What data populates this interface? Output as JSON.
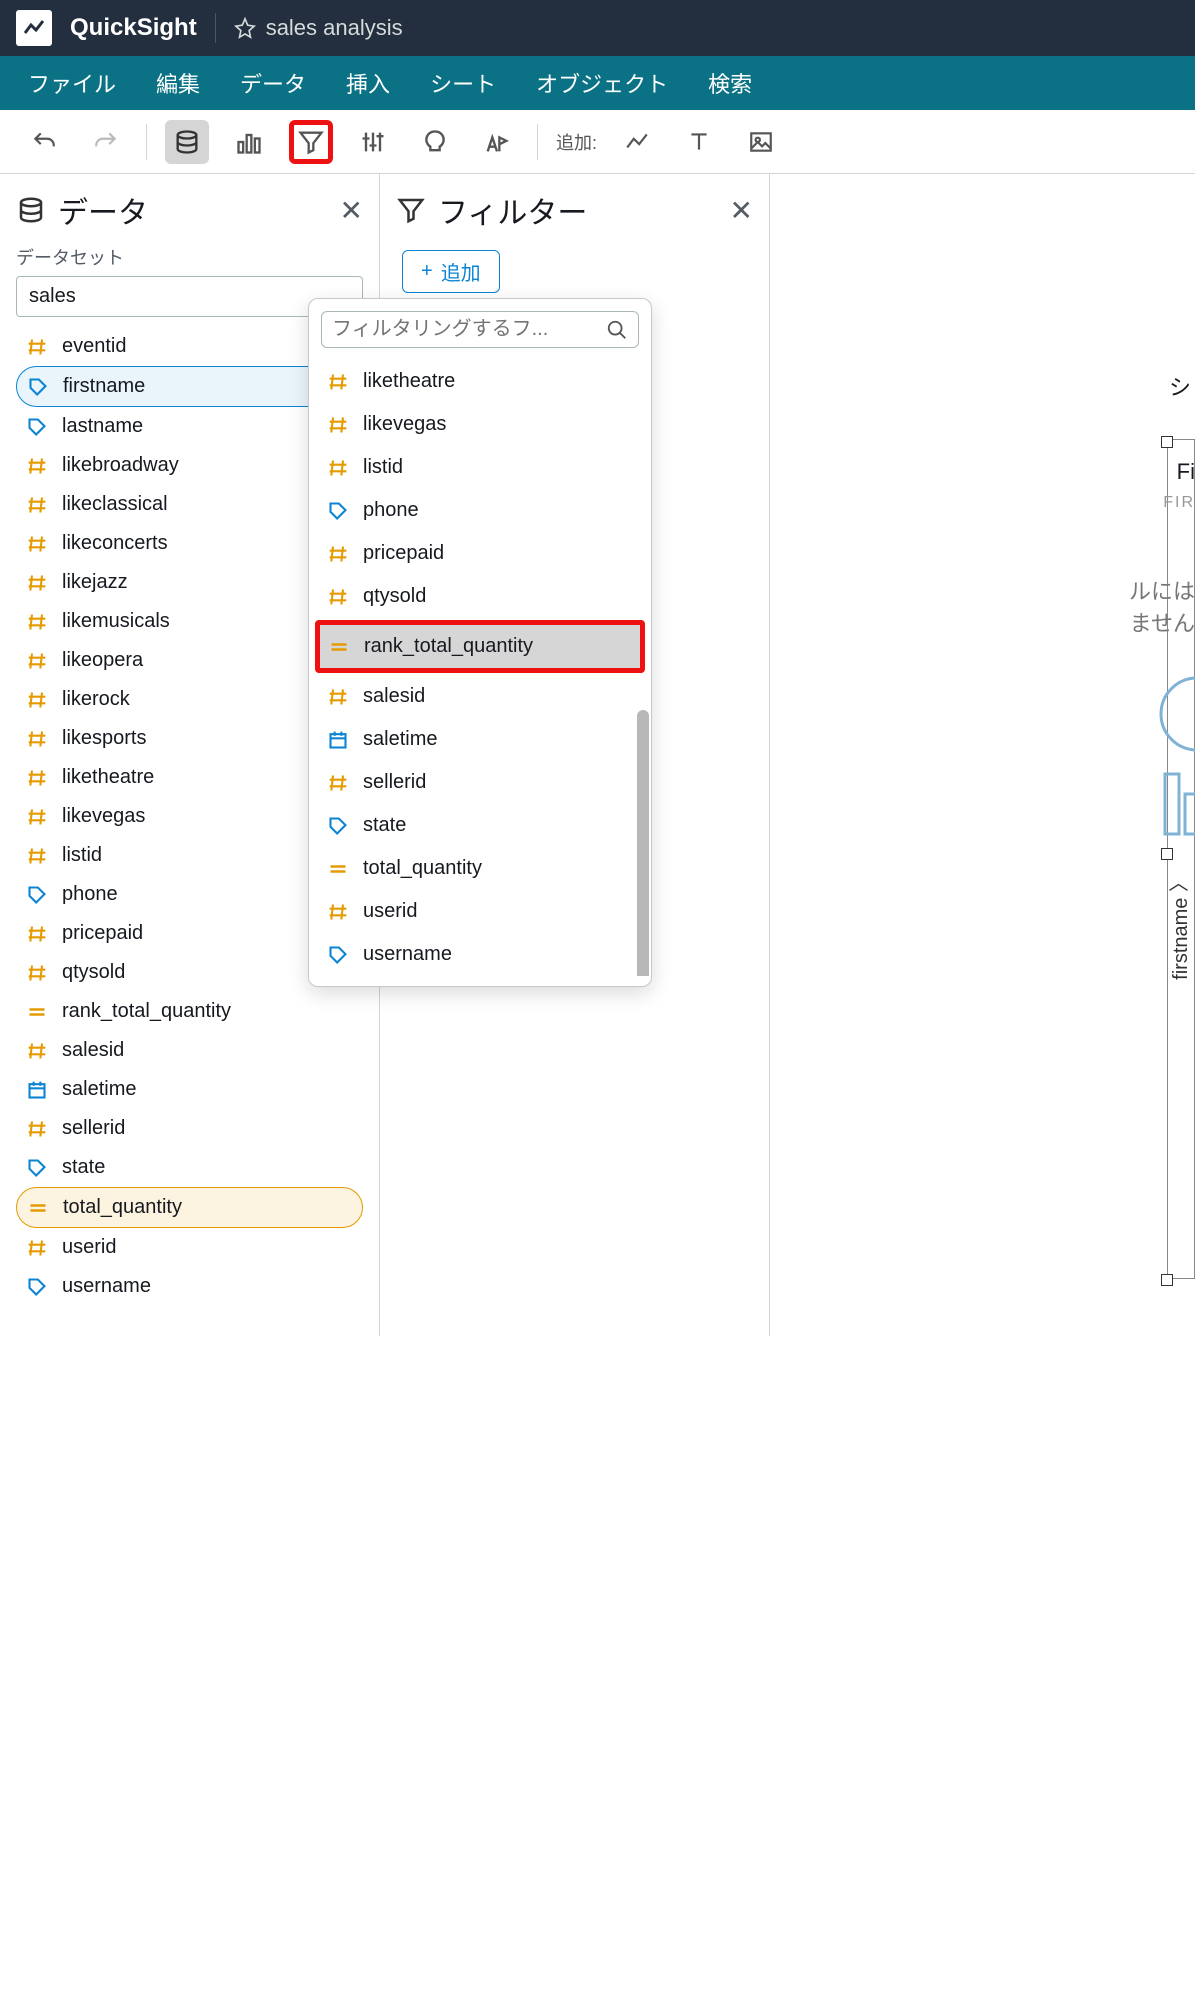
{
  "app": {
    "product": "QuickSight",
    "analysis": "sales analysis"
  },
  "menu": {
    "file": "ファイル",
    "edit": "編集",
    "data": "データ",
    "insert": "挿入",
    "sheet": "シート",
    "object": "オブジェクト",
    "search": "検索"
  },
  "toolbar": {
    "add_label": "追加:"
  },
  "data_panel": {
    "title": "データ",
    "dataset_label": "データセット",
    "dataset_value": "sales",
    "fields": [
      {
        "type": "hash",
        "name": "eventid"
      },
      {
        "type": "tag",
        "name": "firstname",
        "sel": "blue"
      },
      {
        "type": "tag",
        "name": "lastname"
      },
      {
        "type": "hash",
        "name": "likebroadway"
      },
      {
        "type": "hash",
        "name": "likeclassical"
      },
      {
        "type": "hash",
        "name": "likeconcerts"
      },
      {
        "type": "hash",
        "name": "likejazz"
      },
      {
        "type": "hash",
        "name": "likemusicals"
      },
      {
        "type": "hash",
        "name": "likeopera"
      },
      {
        "type": "hash",
        "name": "likerock"
      },
      {
        "type": "hash",
        "name": "likesports"
      },
      {
        "type": "hash",
        "name": "liketheatre"
      },
      {
        "type": "hash",
        "name": "likevegas"
      },
      {
        "type": "hash",
        "name": "listid"
      },
      {
        "type": "tag",
        "name": "phone"
      },
      {
        "type": "hash",
        "name": "pricepaid"
      },
      {
        "type": "hash",
        "name": "qtysold"
      },
      {
        "type": "calc",
        "name": "rank_total_quantity"
      },
      {
        "type": "hash",
        "name": "salesid"
      },
      {
        "type": "date",
        "name": "saletime"
      },
      {
        "type": "hash",
        "name": "sellerid"
      },
      {
        "type": "tag",
        "name": "state"
      },
      {
        "type": "calc",
        "name": "total_quantity",
        "sel": "orange"
      },
      {
        "type": "hash",
        "name": "userid"
      },
      {
        "type": "tag",
        "name": "username"
      }
    ]
  },
  "filter_panel": {
    "title": "フィルター",
    "add_label": "追加"
  },
  "popup": {
    "search_placeholder": "フィルタリングするフ...",
    "items": [
      {
        "type": "hash",
        "name": "liketheatre"
      },
      {
        "type": "hash",
        "name": "likevegas"
      },
      {
        "type": "hash",
        "name": "listid"
      },
      {
        "type": "tag",
        "name": "phone"
      },
      {
        "type": "hash",
        "name": "pricepaid"
      },
      {
        "type": "hash",
        "name": "qtysold"
      },
      {
        "type": "calc",
        "name": "rank_total_quantity",
        "hl": true
      },
      {
        "type": "hash",
        "name": "salesid"
      },
      {
        "type": "date",
        "name": "saletime"
      },
      {
        "type": "hash",
        "name": "sellerid"
      },
      {
        "type": "tag",
        "name": "state"
      },
      {
        "type": "calc",
        "name": "total_quantity"
      },
      {
        "type": "hash",
        "name": "userid"
      },
      {
        "type": "tag",
        "name": "username"
      }
    ]
  },
  "right": {
    "sheet_cut": "シ",
    "vis_title": "Fi",
    "vis_sub": "FIR",
    "no1": "ルには",
    "no2": "ません",
    "rot": "firstname",
    "chev": "〉"
  }
}
